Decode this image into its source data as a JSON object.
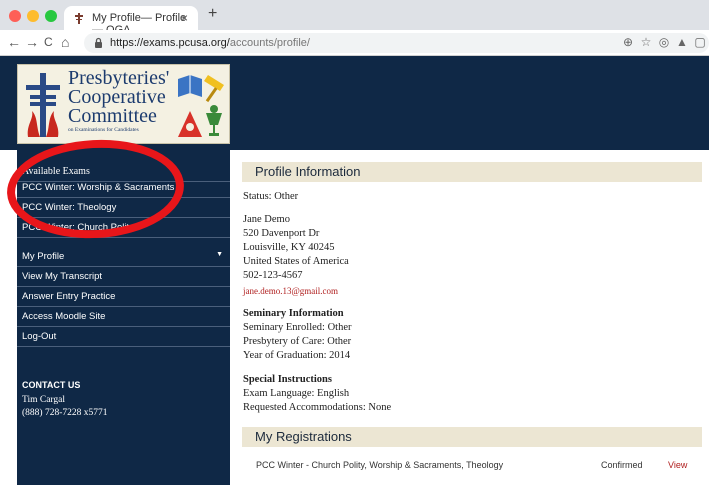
{
  "browser": {
    "tab_title": "My Profile— Profile — OGA",
    "tab_close": "×",
    "new_tab": "+",
    "url_host": "https://exams.pcusa.org/",
    "url_path": "accounts/profile/",
    "nav_back": "←",
    "nav_forward": "→",
    "nav_reload": "C",
    "nav_home": "⌂",
    "url_icons": [
      "⊕",
      "☆",
      "◎",
      "▲",
      "▢"
    ]
  },
  "logo": {
    "lines": [
      "Presbyteries'",
      "Cooperative",
      "Committee"
    ],
    "subtitle": "on Examinations for Candidates"
  },
  "sidebar": {
    "exams_heading": "Available Exams",
    "exams": [
      "PCC Winter: Worship & Sacraments",
      "PCC Winter: Theology",
      "PCC Winter: Church Polity"
    ],
    "menu": [
      "My Profile",
      "View My Transcript",
      "Answer Entry Practice",
      "Access Moodle Site",
      "Log-Out"
    ],
    "contact_heading": "CONTACT US",
    "contact_name": "Tim Cargal",
    "contact_phone": "(888) 728-7228 x5771"
  },
  "profile": {
    "title": "Profile Information",
    "status": "Status: Other",
    "name": "Jane Demo",
    "address1": "520 Davenport Dr",
    "address2": "Louisville, KY 40245",
    "country": "United States of America",
    "phone": "502-123-4567",
    "email": "jane.demo.13@gmail.com",
    "seminary_heading": "Seminary Information",
    "seminary_enrolled": "Seminary Enrolled: Other",
    "presbytery": "Presbytery of Care: Other",
    "graduation": "Year of Graduation: 2014",
    "special_heading": "Special Instructions",
    "exam_language": "Exam Language: English",
    "accommodations": "Requested Accommodations: None"
  },
  "registrations": {
    "title": "My Registrations",
    "rows": [
      {
        "name": "PCC Winter - Church Polity, Worship & Sacraments, Theology",
        "status": "Confirmed",
        "action": "View"
      }
    ]
  },
  "colors": {
    "navy": "#0f2846",
    "section_bg": "#ece6d3",
    "highlight_ring": "#e8161a",
    "link_red": "#b02020"
  }
}
